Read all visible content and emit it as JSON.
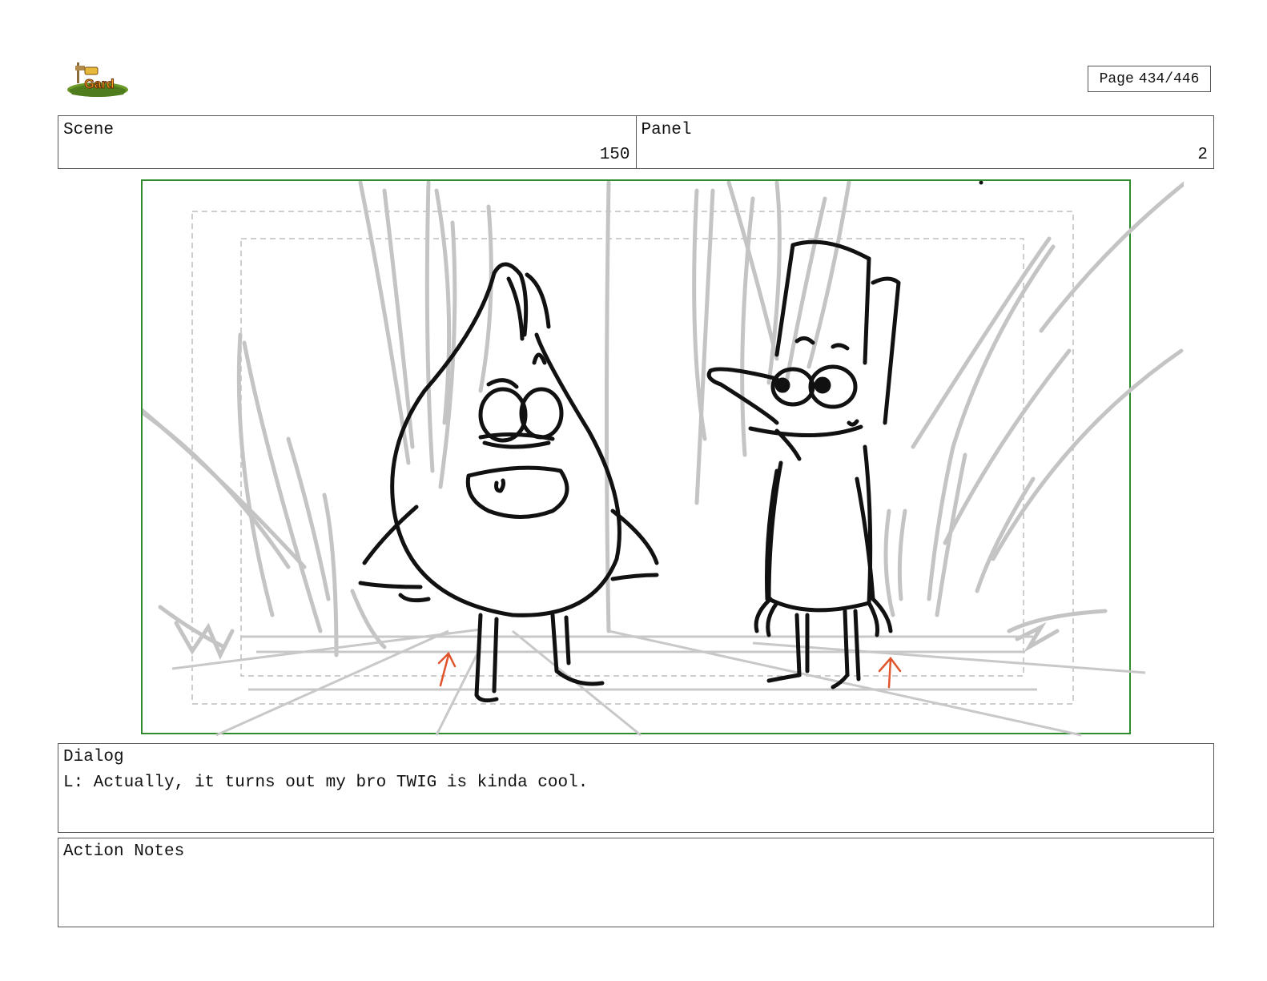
{
  "header": {
    "logo_icon": "show-logo-with-grass-and-sign",
    "page_label": "Page",
    "page_number": "434/446"
  },
  "scene": {
    "label": "Scene",
    "value": "150"
  },
  "panel": {
    "label": "Panel",
    "value": "2"
  },
  "colors": {
    "frame": "#2e8b2e",
    "sketch": "#c4c4c4",
    "ink": "#111111",
    "arrow": "#e0552b"
  },
  "dialog": {
    "label": "Dialog",
    "text": "L: Actually, it turns out my bro TWIG is kinda cool."
  },
  "action_notes": {
    "label": "Action Notes",
    "text": ""
  }
}
